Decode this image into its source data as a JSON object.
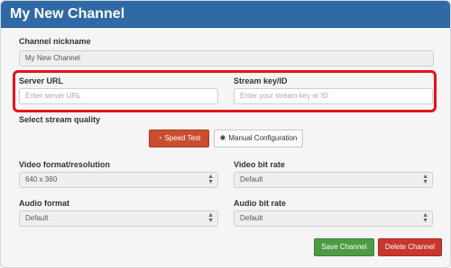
{
  "window": {
    "title": "My New Channel"
  },
  "channel": {
    "nickname_label": "Channel nickname",
    "nickname_value": "My New Channel"
  },
  "server": {
    "url_label": "Server URL",
    "url_placeholder": "Enter server URL",
    "key_label": "Stream key/ID",
    "key_placeholder": "Enter your stream key or ID"
  },
  "quality": {
    "label": "Select stream quality",
    "speed_test_label": "Speed Test",
    "speed_test_icon": "speedometer-icon",
    "manual_label": "Manual Configuration",
    "manual_icon": "gear-icon"
  },
  "video": {
    "format_label": "Video format/resolution",
    "format_value": "640 x 360",
    "bitrate_label": "Video bit rate",
    "bitrate_value": "Default"
  },
  "audio": {
    "format_label": "Audio format",
    "format_value": "Default",
    "bitrate_label": "Audio bit rate",
    "bitrate_value": "Default"
  },
  "actions": {
    "save_label": "Save Channel",
    "delete_label": "Delete Channel"
  },
  "colors": {
    "title_bar": "#2f6aa6",
    "highlight": "#e4141a",
    "speed_test": "#c94e2e",
    "save": "#4f9a44",
    "delete": "#c9362d"
  }
}
